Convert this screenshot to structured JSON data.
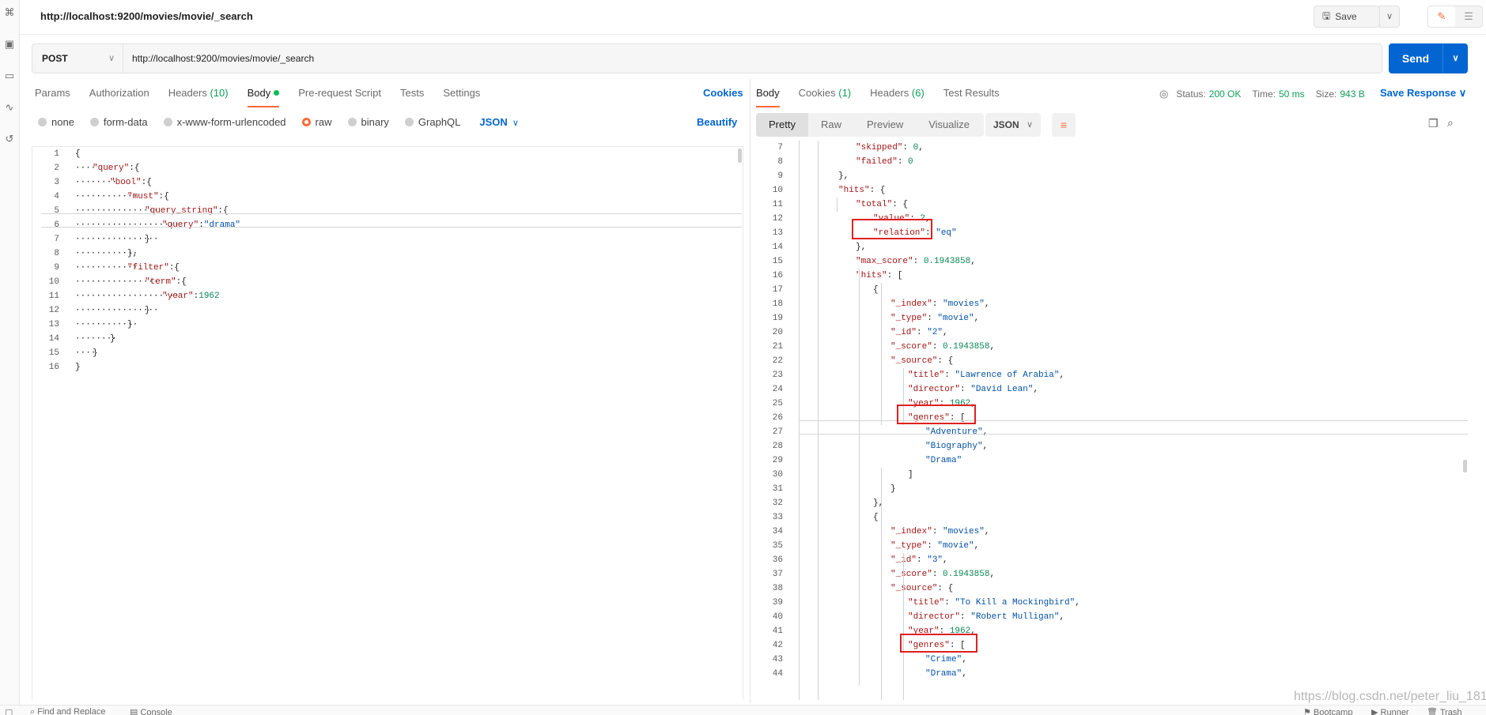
{
  "window": {
    "title": "http://localhost:9200/movies/movie/_search"
  },
  "toolbar": {
    "save_label": "Save"
  },
  "request": {
    "method": "POST",
    "url": "http://localhost:9200/movies/movie/_search",
    "send_label": "Send"
  },
  "request_tabs": {
    "params": "Params",
    "authorization": "Authorization",
    "headers": "Headers",
    "headers_count": "(10)",
    "body": "Body",
    "prerequest": "Pre-request Script",
    "tests": "Tests",
    "settings": "Settings",
    "cookies": "Cookies"
  },
  "body_types": {
    "none": "none",
    "form_data": "form-data",
    "urlencoded": "x-www-form-urlencoded",
    "raw": "raw",
    "binary": "binary",
    "graphql": "GraphQL",
    "format": "JSON",
    "beautify": "Beautify"
  },
  "response_tabs": {
    "body": "Body",
    "cookies": "Cookies",
    "cookies_count": "(1)",
    "headers": "Headers",
    "headers_count": "(6)",
    "test_results": "Test Results"
  },
  "response_meta": {
    "status_label": "Status:",
    "status_value": "200 OK",
    "time_label": "Time:",
    "time_value": "50 ms",
    "size_label": "Size:",
    "size_value": "943 B",
    "save_response": "Save Response"
  },
  "view_tabs": {
    "pretty": "Pretty",
    "raw": "Raw",
    "preview": "Preview",
    "visualize": "Visualize",
    "format": "JSON"
  },
  "footer": {
    "find_replace": "Find and Replace",
    "console": "Console",
    "bootcamp": "Bootcamp",
    "runner": "Runner",
    "trash": "Trash"
  },
  "watermark": "https://blog.csdn.net/peter_liu_181",
  "icons": {
    "accent": "#ff6c37",
    "link": "#0265d2",
    "send": "#0265d2",
    "success": "#0f9d58",
    "highlight": "#e02020"
  },
  "request_body": [
    {
      "n": "1",
      "indent": 0,
      "t": [
        [
          "p",
          "{"
        ]
      ]
    },
    {
      "n": "2",
      "indent": 1,
      "t": [
        [
          "k",
          "\"query\""
        ],
        [
          "p",
          ":{"
        ]
      ]
    },
    {
      "n": "3",
      "indent": 2,
      "t": [
        [
          "k",
          "\"bool\""
        ],
        [
          "p",
          ":{"
        ]
      ]
    },
    {
      "n": "4",
      "indent": 3,
      "t": [
        [
          "k",
          "\"must\""
        ],
        [
          "p",
          ":{"
        ]
      ]
    },
    {
      "n": "5",
      "indent": 4,
      "t": [
        [
          "k",
          "\"query_string\""
        ],
        [
          "p",
          ":{"
        ]
      ]
    },
    {
      "n": "6",
      "indent": 5,
      "t": [
        [
          "k",
          "\"query\""
        ],
        [
          "p",
          ":"
        ],
        [
          "s",
          "\"drama\""
        ]
      ]
    },
    {
      "n": "7",
      "indent": 4,
      "t": [
        [
          "p",
          "}"
        ]
      ]
    },
    {
      "n": "8",
      "indent": 3,
      "t": [
        [
          "p",
          "},"
        ]
      ]
    },
    {
      "n": "9",
      "indent": 3,
      "t": [
        [
          "k",
          "\"filter\""
        ],
        [
          "p",
          ":{"
        ]
      ]
    },
    {
      "n": "10",
      "indent": 4,
      "t": [
        [
          "k",
          "\"term\""
        ],
        [
          "p",
          ":{"
        ]
      ]
    },
    {
      "n": "11",
      "indent": 5,
      "t": [
        [
          "k",
          "\"year\""
        ],
        [
          "p",
          ":"
        ],
        [
          "n",
          "1962"
        ]
      ]
    },
    {
      "n": "12",
      "indent": 4,
      "t": [
        [
          "p",
          "}"
        ]
      ]
    },
    {
      "n": "13",
      "indent": 3,
      "t": [
        [
          "p",
          "}"
        ]
      ]
    },
    {
      "n": "14",
      "indent": 2,
      "t": [
        [
          "p",
          "}"
        ]
      ]
    },
    {
      "n": "15",
      "indent": 1,
      "t": [
        [
          "p",
          "}"
        ]
      ]
    },
    {
      "n": "16",
      "indent": 0,
      "t": [
        [
          "p",
          "}"
        ]
      ]
    }
  ],
  "response_body": [
    {
      "n": "7",
      "indent": 2,
      "t": [
        [
          "k",
          "\"skipped\""
        ],
        [
          "p",
          ": "
        ],
        [
          "n",
          "0"
        ],
        [
          "p",
          ","
        ]
      ]
    },
    {
      "n": "8",
      "indent": 2,
      "t": [
        [
          "k",
          "\"failed\""
        ],
        [
          "p",
          ": "
        ],
        [
          "n",
          "0"
        ]
      ]
    },
    {
      "n": "9",
      "indent": 1,
      "t": [
        [
          "p",
          "},"
        ]
      ]
    },
    {
      "n": "10",
      "indent": 1,
      "t": [
        [
          "k",
          "\"hits\""
        ],
        [
          "p",
          ": {"
        ]
      ]
    },
    {
      "n": "11",
      "indent": 2,
      "t": [
        [
          "k",
          "\"total\""
        ],
        [
          "p",
          ": {"
        ]
      ]
    },
    {
      "n": "12",
      "indent": 3,
      "t": [
        [
          "k",
          "\"value\""
        ],
        [
          "p",
          ": "
        ],
        [
          "n",
          "2"
        ],
        [
          "p",
          ","
        ]
      ]
    },
    {
      "n": "13",
      "indent": 3,
      "t": [
        [
          "k",
          "\"relation\""
        ],
        [
          "p",
          ": "
        ],
        [
          "s",
          "\"eq\""
        ]
      ]
    },
    {
      "n": "14",
      "indent": 2,
      "t": [
        [
          "p",
          "},"
        ]
      ]
    },
    {
      "n": "15",
      "indent": 2,
      "t": [
        [
          "k",
          "\"max_score\""
        ],
        [
          "p",
          ": "
        ],
        [
          "n",
          "0.1943858"
        ],
        [
          "p",
          ","
        ]
      ]
    },
    {
      "n": "16",
      "indent": 2,
      "t": [
        [
          "k",
          "\"hits\""
        ],
        [
          "p",
          ": ["
        ]
      ]
    },
    {
      "n": "17",
      "indent": 3,
      "t": [
        [
          "p",
          "{"
        ]
      ]
    },
    {
      "n": "18",
      "indent": 4,
      "t": [
        [
          "k",
          "\"_index\""
        ],
        [
          "p",
          ": "
        ],
        [
          "s",
          "\"movies\""
        ],
        [
          "p",
          ","
        ]
      ]
    },
    {
      "n": "19",
      "indent": 4,
      "t": [
        [
          "k",
          "\"_type\""
        ],
        [
          "p",
          ": "
        ],
        [
          "s",
          "\"movie\""
        ],
        [
          "p",
          ","
        ]
      ]
    },
    {
      "n": "20",
      "indent": 4,
      "t": [
        [
          "k",
          "\"_id\""
        ],
        [
          "p",
          ": "
        ],
        [
          "s",
          "\"2\""
        ],
        [
          "p",
          ","
        ]
      ]
    },
    {
      "n": "21",
      "indent": 4,
      "t": [
        [
          "k",
          "\"_score\""
        ],
        [
          "p",
          ": "
        ],
        [
          "n",
          "0.1943858"
        ],
        [
          "p",
          ","
        ]
      ]
    },
    {
      "n": "22",
      "indent": 4,
      "t": [
        [
          "k",
          "\"_source\""
        ],
        [
          "p",
          ": {"
        ]
      ]
    },
    {
      "n": "23",
      "indent": 5,
      "t": [
        [
          "k",
          "\"title\""
        ],
        [
          "p",
          ": "
        ],
        [
          "s",
          "\"Lawrence of Arabia\""
        ],
        [
          "p",
          ","
        ]
      ]
    },
    {
      "n": "24",
      "indent": 5,
      "t": [
        [
          "k",
          "\"director\""
        ],
        [
          "p",
          ": "
        ],
        [
          "s",
          "\"David Lean\""
        ],
        [
          "p",
          ","
        ]
      ]
    },
    {
      "n": "25",
      "indent": 5,
      "t": [
        [
          "k",
          "\"year\""
        ],
        [
          "p",
          ": "
        ],
        [
          "n",
          "1962"
        ],
        [
          "p",
          ","
        ]
      ]
    },
    {
      "n": "26",
      "indent": 5,
      "t": [
        [
          "k",
          "\"genres\""
        ],
        [
          "p",
          ": ["
        ]
      ]
    },
    {
      "n": "27",
      "indent": 6,
      "t": [
        [
          "s",
          "\"Adventure\""
        ],
        [
          "p",
          ","
        ]
      ]
    },
    {
      "n": "28",
      "indent": 6,
      "t": [
        [
          "s",
          "\"Biography\""
        ],
        [
          "p",
          ","
        ]
      ]
    },
    {
      "n": "29",
      "indent": 6,
      "t": [
        [
          "s",
          "\"Drama\""
        ]
      ]
    },
    {
      "n": "30",
      "indent": 5,
      "t": [
        [
          "p",
          "]"
        ]
      ]
    },
    {
      "n": "31",
      "indent": 4,
      "t": [
        [
          "p",
          "}"
        ]
      ]
    },
    {
      "n": "32",
      "indent": 3,
      "t": [
        [
          "p",
          "},"
        ]
      ]
    },
    {
      "n": "33",
      "indent": 3,
      "t": [
        [
          "p",
          "{"
        ]
      ]
    },
    {
      "n": "34",
      "indent": 4,
      "t": [
        [
          "k",
          "\"_index\""
        ],
        [
          "p",
          ": "
        ],
        [
          "s",
          "\"movies\""
        ],
        [
          "p",
          ","
        ]
      ]
    },
    {
      "n": "35",
      "indent": 4,
      "t": [
        [
          "k",
          "\"_type\""
        ],
        [
          "p",
          ": "
        ],
        [
          "s",
          "\"movie\""
        ],
        [
          "p",
          ","
        ]
      ]
    },
    {
      "n": "36",
      "indent": 4,
      "t": [
        [
          "k",
          "\"_id\""
        ],
        [
          "p",
          ": "
        ],
        [
          "s",
          "\"3\""
        ],
        [
          "p",
          ","
        ]
      ]
    },
    {
      "n": "37",
      "indent": 4,
      "t": [
        [
          "k",
          "\"_score\""
        ],
        [
          "p",
          ": "
        ],
        [
          "n",
          "0.1943858"
        ],
        [
          "p",
          ","
        ]
      ]
    },
    {
      "n": "38",
      "indent": 4,
      "t": [
        [
          "k",
          "\"_source\""
        ],
        [
          "p",
          ": {"
        ]
      ]
    },
    {
      "n": "39",
      "indent": 5,
      "t": [
        [
          "k",
          "\"title\""
        ],
        [
          "p",
          ": "
        ],
        [
          "s",
          "\"To Kill a Mockingbird\""
        ],
        [
          "p",
          ","
        ]
      ]
    },
    {
      "n": "40",
      "indent": 5,
      "t": [
        [
          "k",
          "\"director\""
        ],
        [
          "p",
          ": "
        ],
        [
          "s",
          "\"Robert Mulligan\""
        ],
        [
          "p",
          ","
        ]
      ]
    },
    {
      "n": "41",
      "indent": 5,
      "t": [
        [
          "k",
          "\"year\""
        ],
        [
          "p",
          ": "
        ],
        [
          "n",
          "1962"
        ],
        [
          "p",
          ","
        ]
      ]
    },
    {
      "n": "42",
      "indent": 5,
      "t": [
        [
          "k",
          "\"genres\""
        ],
        [
          "p",
          ": ["
        ]
      ]
    },
    {
      "n": "43",
      "indent": 6,
      "t": [
        [
          "s",
          "\"Crime\""
        ],
        [
          "p",
          ","
        ]
      ]
    },
    {
      "n": "44",
      "indent": 6,
      "t": [
        [
          "s",
          "\"Drama\""
        ],
        [
          "p",
          ","
        ]
      ]
    }
  ]
}
